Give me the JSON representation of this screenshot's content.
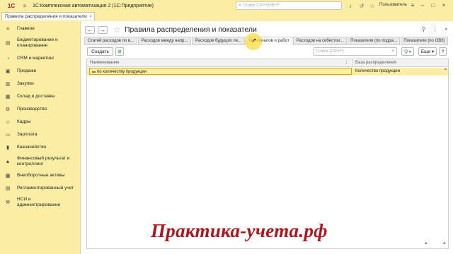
{
  "titlebar": {
    "app_title": "1С:Комплексная автоматизация 2  (1С:Предприятие)",
    "search_placeholder": "Поиск Ctrl+Shift+F",
    "user_name": "Пользователь"
  },
  "open_tab": {
    "label": "Правила распределения и показатели"
  },
  "sidebar": {
    "items": [
      {
        "label": "Главное",
        "icon": "menu-icon"
      },
      {
        "label": "Бюджетирование и планирование",
        "icon": "budget-icon"
      },
      {
        "label": "CRM и маркетинг",
        "icon": "crm-icon"
      },
      {
        "label": "Продажи",
        "icon": "sales-icon"
      },
      {
        "label": "Закупки",
        "icon": "purchases-icon"
      },
      {
        "label": "Склад и доставка",
        "icon": "warehouse-icon"
      },
      {
        "label": "Производство",
        "icon": "production-icon"
      },
      {
        "label": "Кадры",
        "icon": "hr-icon"
      },
      {
        "label": "Зарплата",
        "icon": "salary-icon"
      },
      {
        "label": "Казначейство",
        "icon": "treasury-icon"
      },
      {
        "label": "Финансовый результат и контроллинг",
        "icon": "finance-icon"
      },
      {
        "label": "Внеоборотные активы",
        "icon": "assets-icon"
      },
      {
        "label": "Регламентированный учет",
        "icon": "accounting-icon"
      },
      {
        "label": "НСИ и администрирование",
        "icon": "admin-icon"
      }
    ]
  },
  "form": {
    "title": "Правила распределения и показатели",
    "tabs": [
      {
        "label": "Статей расходов по в..."
      },
      {
        "label": "Расходов между напр..."
      },
      {
        "label": "Расходов будущих пе..."
      },
      {
        "label": "Материалов и работ"
      },
      {
        "label": "Расходов на себестои..."
      },
      {
        "label": "Показатели (по подра..."
      },
      {
        "label": "Показатели (по ОВЗ)"
      }
    ],
    "active_tab_index": 3
  },
  "toolbar": {
    "create_label": "Создать",
    "search_placeholder": "Поиск (Ctrl+F)",
    "clear_symbol": "×",
    "find_label": "Q ▾",
    "more_label": "Еще ▾",
    "help_label": "?"
  },
  "table": {
    "columns": [
      "Наименование",
      "База распределения"
    ],
    "rows": [
      {
        "name": "по количеству продукции",
        "base": "Количество продукции"
      }
    ]
  },
  "watermark": {
    "text": "Практика-учета.рф"
  },
  "colors": {
    "panel_bg": "#fbeea4",
    "selected_row": "#fbeea4",
    "watermark": "#b5121b"
  }
}
